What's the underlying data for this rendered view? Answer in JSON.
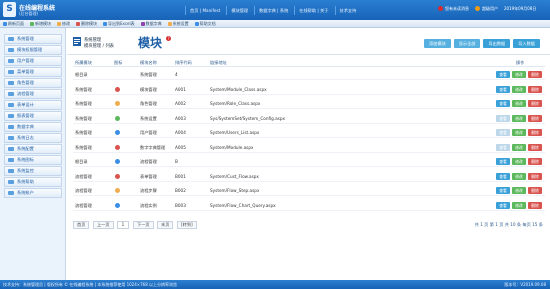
{
  "header": {
    "logo": "S",
    "title": "在线编程系统",
    "subtitle": "(后台管理)",
    "nav": [
      "首页 | Manifest",
      "模块管理",
      "数据字典 | 系统",
      "在线帮助 | 关于",
      "技术支持"
    ],
    "user_alert": "您有未读消息",
    "user_name": "超级用户",
    "datetime": "2019年09月08日"
  },
  "toolbar": {
    "items": [
      {
        "label": "刷新页面",
        "color": "#3a8ee6"
      },
      {
        "label": "新增模块",
        "color": "#5cb85c"
      },
      {
        "label": "修改",
        "color": "#f0ad4e"
      },
      {
        "label": "删除模块",
        "color": "#d9534f"
      },
      {
        "label": "导出到Excel表",
        "color": "#3a8ee6"
      },
      {
        "label": "数据字典",
        "color": "#8e44ad"
      },
      {
        "label": "系统设置",
        "color": "#f0ad4e"
      },
      {
        "label": "帮助文档",
        "color": "#3a8ee6"
      }
    ]
  },
  "sidebar": {
    "items": [
      "系统管理",
      "模块权限管理",
      "用户管理",
      "菜单管理",
      "角色管理",
      "流程管理",
      "表单设计",
      "报表管理",
      "数据字典",
      "系统日志",
      "系统配置",
      "系统图标",
      "系统监控",
      "系统帮助",
      "系统帐户"
    ]
  },
  "main": {
    "breadcrumb1": "系统管理",
    "breadcrumb2": "模块管理 / 列表",
    "title": "模块",
    "help": "?",
    "buttons": [
      {
        "label": "添加模块",
        "color": "#55b0e0"
      },
      {
        "label": "显示全部",
        "color": "#55b0e0"
      },
      {
        "label": "导出数据",
        "color": "#3aa0d8"
      },
      {
        "label": "导入数据",
        "color": "#3aa0d8"
      }
    ]
  },
  "table": {
    "columns": [
      "所属模块",
      "图标",
      "模块名称",
      "排序代码",
      "链接地址",
      "操作"
    ],
    "rows": [
      {
        "parent": "根目录",
        "icon_color": "",
        "name": "系统管理",
        "sort": "4",
        "url": "",
        "view_enabled": true
      },
      {
        "parent": "系统管理",
        "icon_color": "#d9534f",
        "name": "模块管理",
        "sort": "A001",
        "url": "System/Module_Class.aspx",
        "view_enabled": true
      },
      {
        "parent": "系统管理",
        "icon_color": "#f0ad4e",
        "name": "角色管理",
        "sort": "A002",
        "url": "System/Role_Class.aspx",
        "view_enabled": true
      },
      {
        "parent": "系统管理",
        "icon_color": "#5cb85c",
        "name": "系统设置",
        "sort": "A003",
        "url": "Sys/SystemSet/System_Config.aspx",
        "view_enabled": false
      },
      {
        "parent": "系统管理",
        "icon_color": "#3a8ee6",
        "name": "用户管理",
        "sort": "A004",
        "url": "System/Users_List.aspx",
        "view_enabled": false
      },
      {
        "parent": "系统管理",
        "icon_color": "#d9534f",
        "name": "数字字典管理",
        "sort": "A005",
        "url": "System/Module.aspx",
        "view_enabled": false
      },
      {
        "parent": "根目录",
        "icon_color": "#3a8ee6",
        "name": "流程管理",
        "sort": "B",
        "url": "",
        "view_enabled": true
      },
      {
        "parent": "流程管理",
        "icon_color": "#d9534f",
        "name": "表单管理",
        "sort": "B001",
        "url": "System/Cust_Flow.aspx",
        "view_enabled": true
      },
      {
        "parent": "流程管理",
        "icon_color": "#f0ad4e",
        "name": "流程步骤",
        "sort": "B002",
        "url": "System/Flow_Step.aspx",
        "view_enabled": true
      },
      {
        "parent": "流程管理",
        "icon_color": "#3a8ee6",
        "name": "流程实例",
        "sort": "B003",
        "url": "System/Flow_Chart_Query.aspx",
        "view_enabled": true
      }
    ],
    "view_label": "查看",
    "edit_label": "修改",
    "delete_label": "删除"
  },
  "pager": {
    "first": "首页",
    "prev": "上一页",
    "page": "1",
    "next": "下一页",
    "last": "末页",
    "go": "[转到]",
    "info": "共 1 页 第 1 页 共 10 条 每页 15 条"
  },
  "footer": {
    "left": "技术支持：系统管理员 | 版权所有 © 在线编程系统 | 本系统推荐使用 1024×768 以上分辨率浏览",
    "right": "版本号：V2019.09.08"
  }
}
